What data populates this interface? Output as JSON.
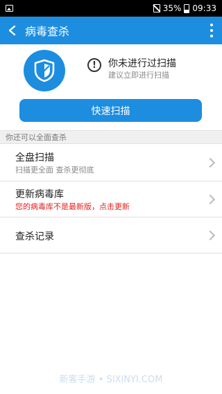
{
  "status_bar": {
    "battery": "35%",
    "time": "09:33",
    "icons": [
      "image-icon",
      "sim-off-icon",
      "battery-icon"
    ]
  },
  "app_bar": {
    "title": "病毒查杀",
    "back_icon": "back-arrow-icon",
    "menu_icon": "more-vertical-icon"
  },
  "hero": {
    "shield_icon": "shield-icon",
    "warning_icon": "exclamation-circle-icon",
    "warning_title": "你未进行过扫描",
    "warning_subtitle": "建议立即进行扫描"
  },
  "quick_scan_label": "快速扫描",
  "section_label": "你还可以全面查杀",
  "items": [
    {
      "label": "全盘扫描",
      "sub": "扫描更全面 查杀更彻底"
    },
    {
      "label": "更新病毒库",
      "sub": "您的病毒库不是最新版，点击更新"
    },
    {
      "label": "查杀记录",
      "sub": ""
    }
  ],
  "watermark": "新客手游 • SIXINYI.COM",
  "colors": {
    "accent": "#1d8de0",
    "alert": "#e61e1e"
  }
}
